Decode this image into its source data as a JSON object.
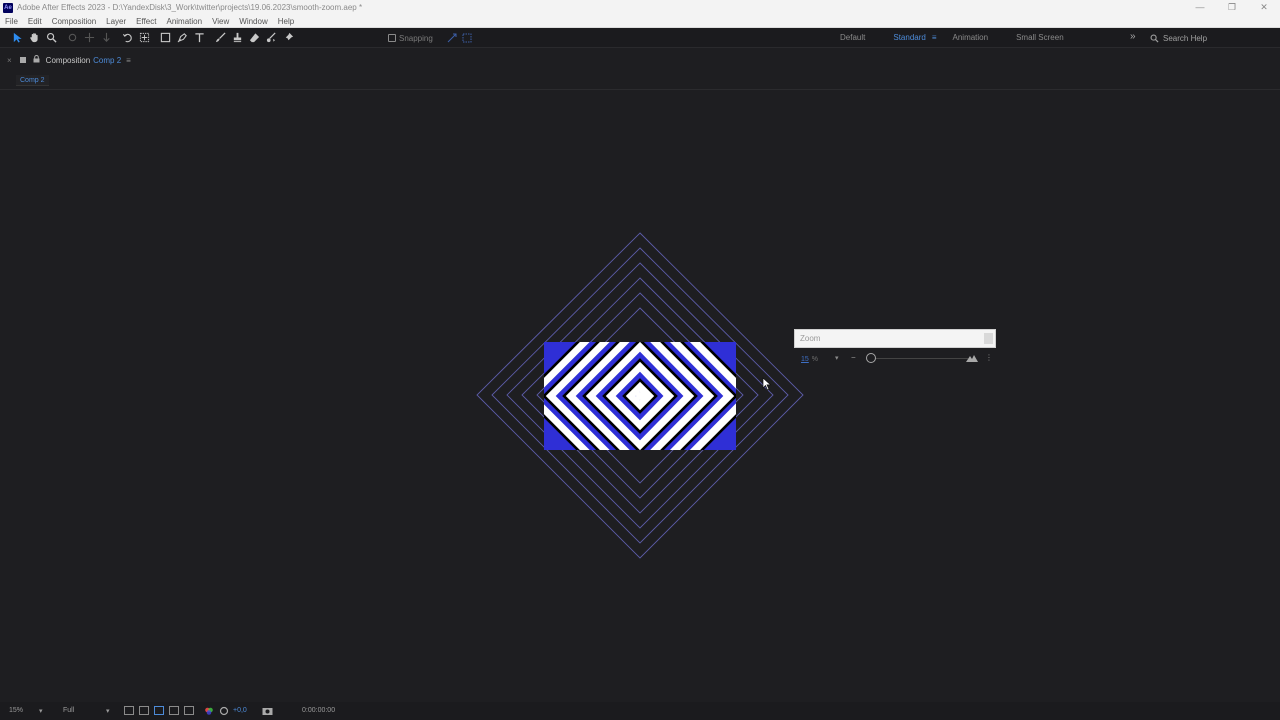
{
  "window": {
    "title": "Adobe After Effects 2023 - D:\\YandexDisk\\3_Work\\twitter\\projects\\19.06.2023\\smooth-zoom.aep *",
    "app_icon_label": "Ae",
    "minimize_glyph": "—",
    "restore_glyph": "❐",
    "close_glyph": "✕"
  },
  "menu": [
    "File",
    "Edit",
    "Composition",
    "Layer",
    "Effect",
    "Animation",
    "View",
    "Window",
    "Help"
  ],
  "toolbar": {
    "tools": [
      "selection-tool",
      "hand-tool",
      "zoom-tool",
      "orbit-camera-tool",
      "pan-camera-tool",
      "dolly-camera-tool",
      "rotation-tool",
      "anchor-point-tool",
      "rectangle-tool",
      "pen-tool",
      "type-tool",
      "brush-tool",
      "clone-stamp-tool",
      "eraser-tool",
      "roto-brush-tool",
      "puppet-pin-tool"
    ],
    "snapping_label": "Snapping",
    "workspaces": {
      "default": "Default",
      "standard": "Standard",
      "animation": "Animation",
      "small_screen": "Small Screen"
    },
    "expand_glyph": "»",
    "search_label": "Search Help"
  },
  "panel": {
    "close_glyph": "×",
    "lock_glyph": "🔒",
    "title": "Composition",
    "comp_name": "Comp 2",
    "menu_glyph": "≡",
    "subtab": "Comp 2"
  },
  "zoom_popup": {
    "field_placeholder": "Zoom",
    "value": "15",
    "unit": "%",
    "chevron": "▾",
    "minus": "−",
    "more": "⋮"
  },
  "bottom": {
    "zoom": "15%",
    "zoom_chevron": "▾",
    "resolution": "Full",
    "resolution_chevron": "▾",
    "exposure": "+0,0",
    "timecode": "0:00:00:00"
  },
  "colors": {
    "accent": "#4d8bd8",
    "artwork_blue": "#2f2fd6",
    "outline": "#6a6ab8"
  }
}
